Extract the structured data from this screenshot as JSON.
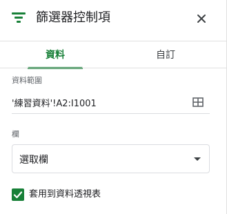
{
  "header": {
    "icon": "filter-icon",
    "title": "篩選器控制項",
    "close_icon": "close-icon"
  },
  "tabs": [
    {
      "label": "資料",
      "active": true
    },
    {
      "label": "自訂",
      "active": false
    }
  ],
  "data_range": {
    "label": "資料範圍",
    "value": "'練習資料'!A2:I1001",
    "icon": "grid-icon"
  },
  "column": {
    "label": "欄",
    "selected": "選取欄"
  },
  "apply_to_pivot": {
    "label": "套用到資料透視表",
    "checked": true
  },
  "colors": {
    "accent": "#188038",
    "text": "#202124",
    "border": "#dadce0"
  }
}
